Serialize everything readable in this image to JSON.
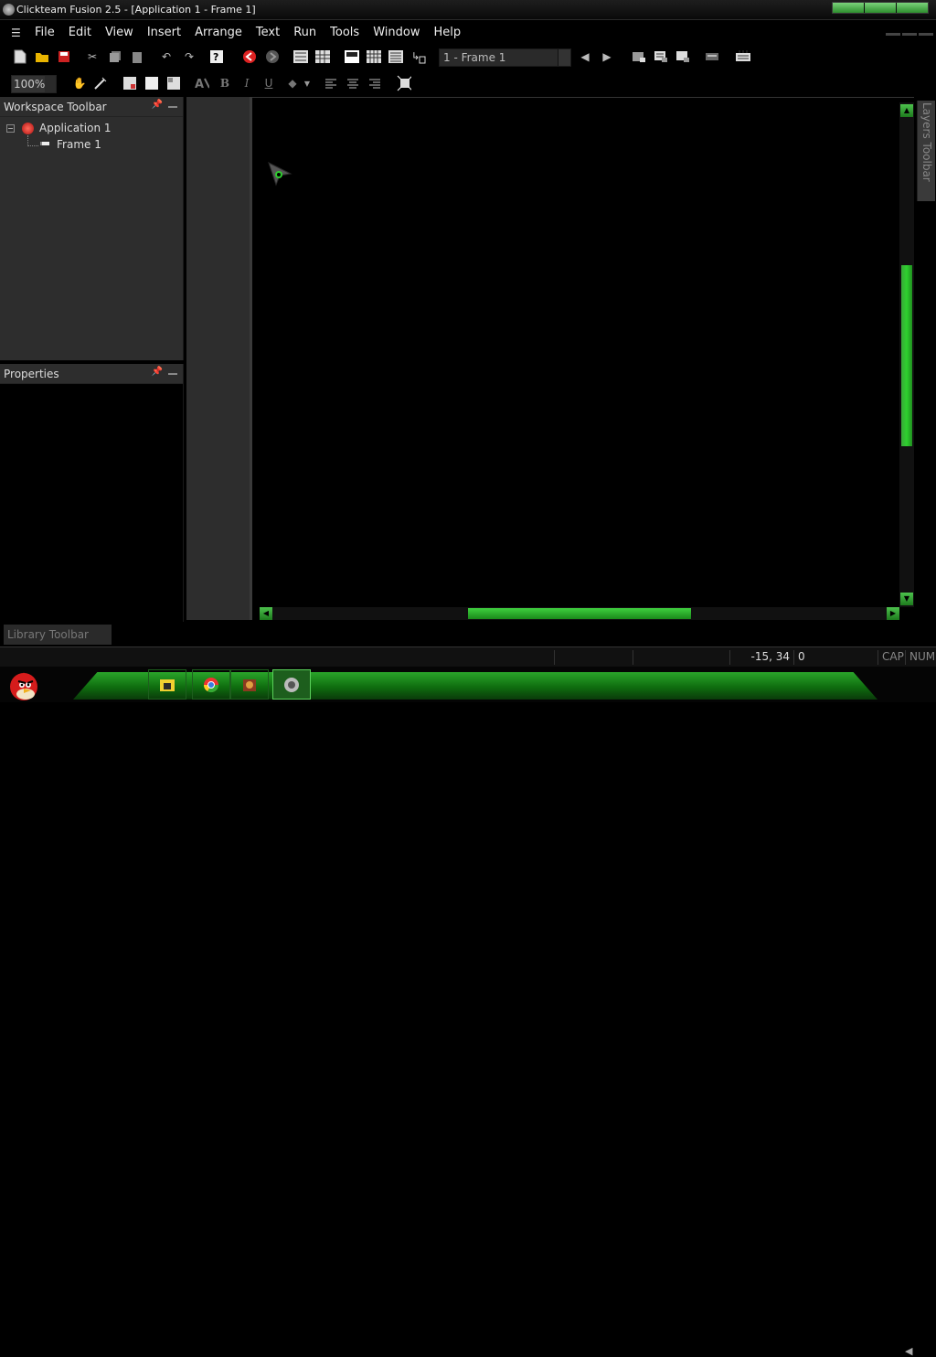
{
  "window": {
    "title": "Clickteam Fusion 2.5 - [Application 1 - Frame 1]"
  },
  "menu": {
    "items": [
      "File",
      "Edit",
      "View",
      "Insert",
      "Arrange",
      "Text",
      "Run",
      "Tools",
      "Window",
      "Help"
    ]
  },
  "toolbar": {
    "frame_select": "1 - Frame 1",
    "zoom": "100%",
    "icons": [
      "new-icon",
      "open-icon",
      "save-icon",
      "cut-icon",
      "copy-icon",
      "paste-icon",
      "undo-icon",
      "redo-icon",
      "help-icon",
      "back-icon",
      "forward-icon",
      "storyboard-icon",
      "frame-editor-icon",
      "event-editor-icon",
      "event-list-icon",
      "data-elements-icon",
      "run-app-icon"
    ]
  },
  "workspace": {
    "header": "Workspace Toolbar",
    "tree": {
      "application": "Application 1",
      "frame": "Frame 1"
    }
  },
  "properties": {
    "header": "Properties"
  },
  "layers": {
    "label": "Layers Toolbar"
  },
  "library": {
    "label": "Library Toolbar"
  },
  "status": {
    "coords": "-15, 34",
    "value": "0",
    "cap": "CAP",
    "num": "NUM"
  },
  "colors": {
    "accent": "#2ecc2e",
    "background": "#000000",
    "panel": "#2d2d2d"
  }
}
